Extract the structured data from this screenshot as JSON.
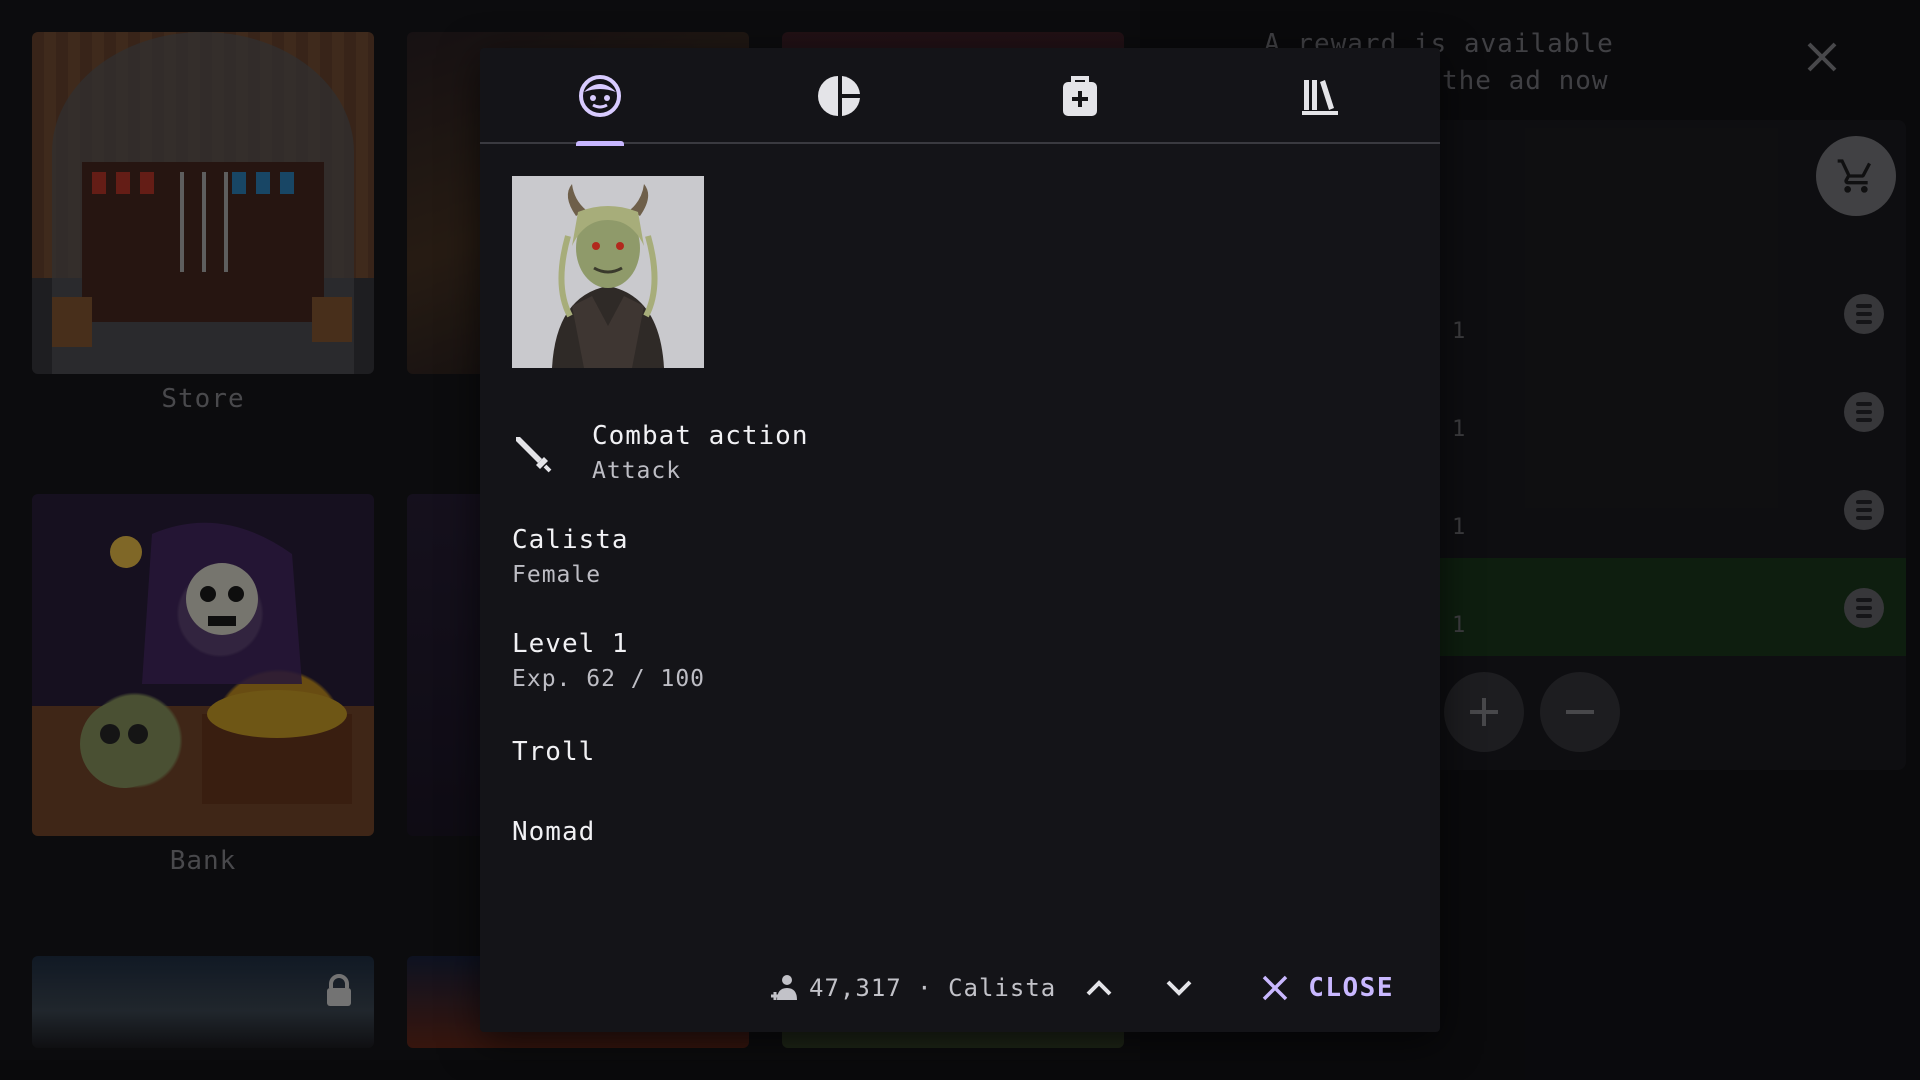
{
  "background": {
    "locations": [
      {
        "name": "Store",
        "locked": false
      },
      {
        "name": "",
        "locked": false
      },
      {
        "name": "",
        "locked": false
      },
      {
        "name": "Bank",
        "locked": false
      },
      {
        "name": "",
        "locked": false
      },
      {
        "name": "",
        "locked": true
      },
      {
        "name": "",
        "locked": false
      },
      {
        "name": "",
        "locked": false
      }
    ],
    "ad_banner": {
      "line1": "A reward is available",
      "line2": "the ad now"
    },
    "queue_rows": [
      "1",
      "1",
      "1",
      "1"
    ]
  },
  "dialog": {
    "tabs": [
      {
        "name": "character",
        "icon": "face-icon"
      },
      {
        "name": "stats",
        "icon": "pie-chart-icon"
      },
      {
        "name": "inventory",
        "icon": "medical-bag-icon"
      },
      {
        "name": "library",
        "icon": "books-icon"
      }
    ],
    "active_tab": "character",
    "combat_action": {
      "label": "Combat action",
      "value": "Attack"
    },
    "character": {
      "name": "Calista",
      "gender": "Female",
      "level": "Level 1",
      "exp": "Exp. 62 / 100",
      "race": "Troll",
      "class": "Nomad"
    },
    "footer": {
      "summary": "47,317 · Calista",
      "close_label": "CLOSE"
    }
  },
  "colors": {
    "accent": "#c7b6ff",
    "selected_row": "#1b3a1d"
  }
}
